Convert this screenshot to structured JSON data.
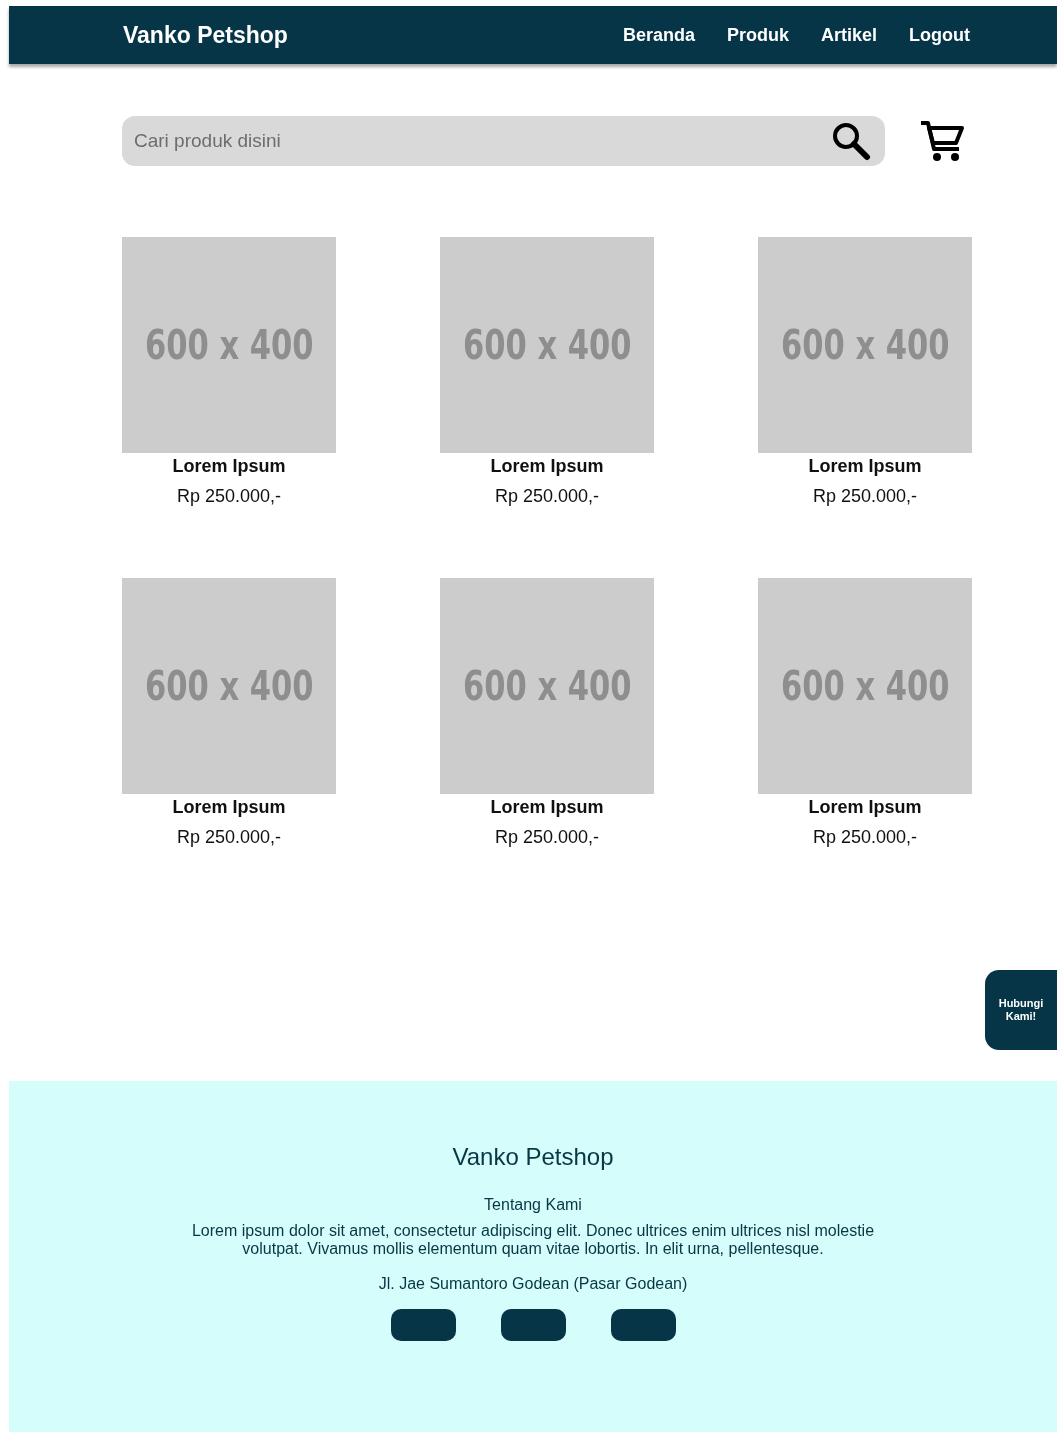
{
  "navbar": {
    "brand": "Vanko Petshop",
    "links": [
      "Beranda",
      "Produk",
      "Artikel",
      "Logout"
    ]
  },
  "search": {
    "placeholder": "Cari produk disini"
  },
  "products": [
    {
      "image_label": "600 x 400",
      "name": "Lorem Ipsum",
      "price": "Rp 250.000,-"
    },
    {
      "image_label": "600 x 400",
      "name": "Lorem Ipsum",
      "price": "Rp 250.000,-"
    },
    {
      "image_label": "600 x 400",
      "name": "Lorem Ipsum",
      "price": "Rp 250.000,-"
    },
    {
      "image_label": "600 x 400",
      "name": "Lorem Ipsum",
      "price": "Rp 250.000,-"
    },
    {
      "image_label": "600 x 400",
      "name": "Lorem Ipsum",
      "price": "Rp 250.000,-"
    },
    {
      "image_label": "600 x 400",
      "name": "Lorem Ipsum",
      "price": "Rp 250.000,-"
    }
  ],
  "contact_button": {
    "label": "Hubungi Kami!"
  },
  "footer": {
    "title": "Vanko Petshop",
    "about_heading": "Tentang Kami",
    "about_text": "Lorem ipsum dolor sit amet, consectetur adipiscing elit. Donec ultrices enim ultrices nisl molestie volutpat. Vivamus mollis elementum quam vitae lobortis. In elit urna, pellentesque.",
    "address": "Jl. Jae Sumantoro Godean (Pasar Godean)",
    "social_buttons": [
      {
        "kind": "link"
      },
      {
        "kind": "link"
      },
      {
        "kind": "link"
      }
    ]
  }
}
